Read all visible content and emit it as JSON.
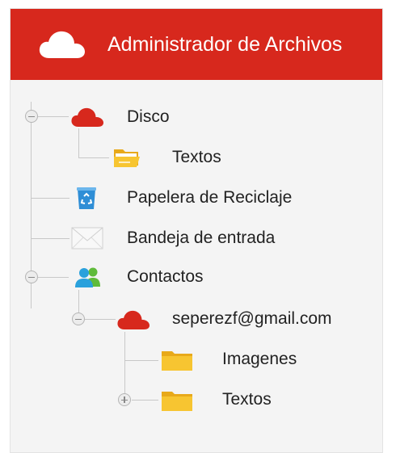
{
  "header": {
    "title": "Administrador de Archivos",
    "icon": "cloud-icon",
    "background": "#d7281d"
  },
  "tree": {
    "disco": {
      "label": "Disco",
      "icon": "cloud-icon",
      "expanded": true
    },
    "disco_textos": {
      "label": "Textos",
      "icon": "folder-open-icon"
    },
    "papelera": {
      "label": "Papelera de Reciclaje",
      "icon": "recycle-bin-icon"
    },
    "bandeja": {
      "label": "Bandeja de entrada",
      "icon": "envelope-icon"
    },
    "contactos": {
      "label": "Contactos",
      "icon": "users-icon",
      "expanded": true
    },
    "contacto_email": {
      "label": "seperezf@gmail.com",
      "icon": "cloud-icon",
      "expanded": true
    },
    "imagenes": {
      "label": "Imagenes",
      "icon": "folder-icon"
    },
    "email_textos": {
      "label": "Textos",
      "icon": "folder-icon",
      "expanded": false
    }
  },
  "colors": {
    "accent": "#d7281d",
    "folder": "#f5c518",
    "users": "#2aa1dc"
  }
}
